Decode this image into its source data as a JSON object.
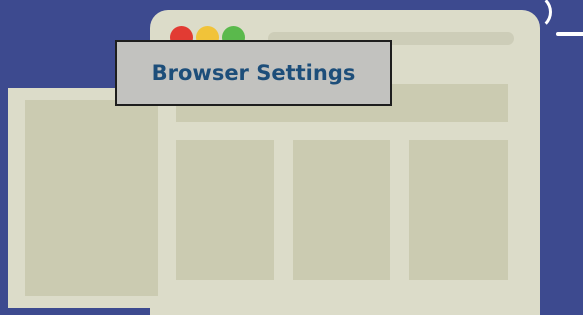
{
  "title_box": {
    "label": "Browser Settings"
  },
  "window_controls": {
    "close_color": "#e23b33",
    "minimize_color": "#f1c339",
    "maximize_color": "#5ab94c"
  },
  "colors": {
    "background": "#3d4a8f",
    "window": "#dcdcc9",
    "panel": "#cbcbb1",
    "title_text": "#1d4e7a"
  },
  "icons": [
    "browser-window-illustration",
    "close-dot-icon",
    "minimize-dot-icon",
    "maximize-dot-icon",
    "sparkle-icon"
  ]
}
